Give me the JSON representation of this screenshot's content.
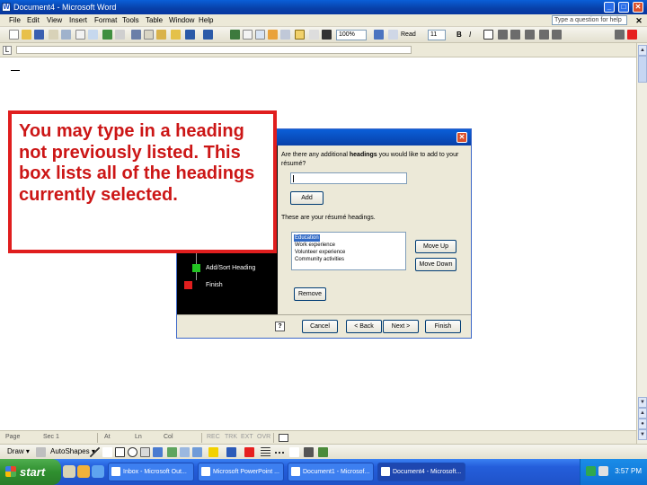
{
  "window": {
    "title": "Document4 - Microsoft Word",
    "minimize": "_",
    "maximize": "□",
    "close": "✕"
  },
  "menubar": {
    "items": [
      "File",
      "Edit",
      "View",
      "Insert",
      "Format",
      "Tools",
      "Table",
      "Window",
      "Help"
    ],
    "help_placeholder": "Type a question for help",
    "close": "✕"
  },
  "toolbar": {
    "zoom": "100%",
    "read_label": "Read",
    "font_size": "11",
    "bold": "B",
    "italic": "I"
  },
  "dialog": {
    "close": "✕",
    "steps": [
      {
        "label": "Add/Sort Heading",
        "color": "#22c422"
      },
      {
        "label": "Finish",
        "color": "#e01e1e"
      }
    ],
    "question_pre": "Are there any additional ",
    "question_bold": "headings",
    "question_post": " you would like to add to your résumé?",
    "add_button": "Add",
    "list_label": "These are your résumé headings.",
    "headings": [
      "Education",
      "Work experience",
      "Volunteer experience",
      "Community activities"
    ],
    "selected_index": 0,
    "move_up": "Move Up",
    "move_down": "Move Down",
    "remove": "Remove",
    "help": "?",
    "cancel": "Cancel",
    "back": "< Back",
    "next": "Next >",
    "finish": "Finish"
  },
  "callout": {
    "text": "You may type in a heading not previously listed. This box lists all of the headings currently selected."
  },
  "statusbar": {
    "page": "Page",
    "sec": "Sec 1",
    "at": "At",
    "ln": "Ln",
    "col": "Col",
    "rec": "REC",
    "trk": "TRK",
    "ext": "EXT",
    "ovr": "OVR"
  },
  "drawbar": {
    "draw": "Draw ▾",
    "autoshapes": "AutoShapes ▾"
  },
  "taskbar": {
    "start": "start",
    "tasks": [
      {
        "label": "Inbox - Microsoft Out..."
      },
      {
        "label": "Microsoft PowerPoint ..."
      },
      {
        "label": "Document1 - Microsof..."
      },
      {
        "label": "Document4 - Microsoft..."
      }
    ],
    "active_task_index": 3,
    "clock": "3:57 PM"
  }
}
